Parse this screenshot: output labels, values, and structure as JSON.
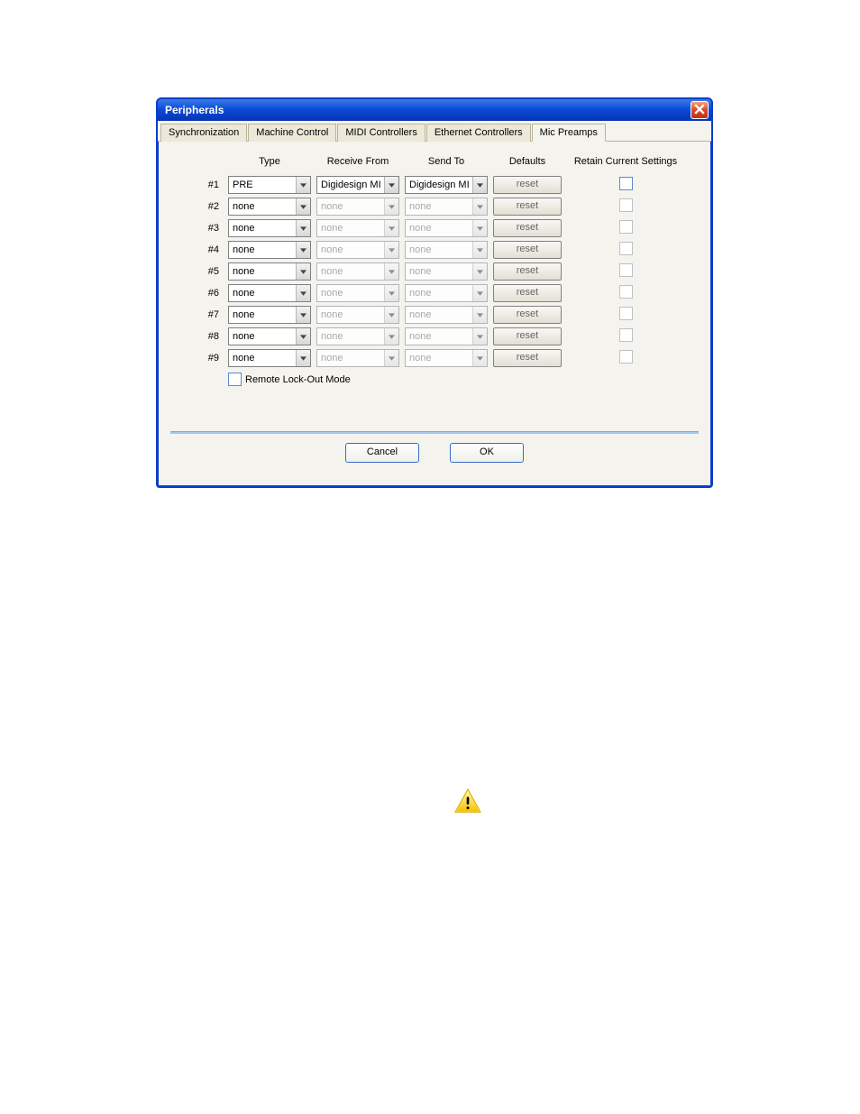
{
  "dialog": {
    "title": "Peripherals",
    "tabs": [
      {
        "label": "Synchronization",
        "active": false
      },
      {
        "label": "Machine Control",
        "active": false
      },
      {
        "label": "MIDI Controllers",
        "active": false
      },
      {
        "label": "Ethernet Controllers",
        "active": false
      },
      {
        "label": "Mic Preamps",
        "active": true
      }
    ],
    "columns": {
      "type": "Type",
      "receive": "Receive From",
      "send": "Send To",
      "defaults": "Defaults",
      "retain": "Retain Current Settings"
    },
    "rows": [
      {
        "num": "#1",
        "type": "PRE",
        "receive": "Digidesign MI",
        "send": "Digidesign MI",
        "reset": "reset",
        "enabled": true,
        "retain": false
      },
      {
        "num": "#2",
        "type": "none",
        "receive": "none",
        "send": "none",
        "reset": "reset",
        "enabled": false,
        "retain": false
      },
      {
        "num": "#3",
        "type": "none",
        "receive": "none",
        "send": "none",
        "reset": "reset",
        "enabled": false,
        "retain": false
      },
      {
        "num": "#4",
        "type": "none",
        "receive": "none",
        "send": "none",
        "reset": "reset",
        "enabled": false,
        "retain": false
      },
      {
        "num": "#5",
        "type": "none",
        "receive": "none",
        "send": "none",
        "reset": "reset",
        "enabled": false,
        "retain": false
      },
      {
        "num": "#6",
        "type": "none",
        "receive": "none",
        "send": "none",
        "reset": "reset",
        "enabled": false,
        "retain": false
      },
      {
        "num": "#7",
        "type": "none",
        "receive": "none",
        "send": "none",
        "reset": "reset",
        "enabled": false,
        "retain": false
      },
      {
        "num": "#8",
        "type": "none",
        "receive": "none",
        "send": "none",
        "reset": "reset",
        "enabled": false,
        "retain": false
      },
      {
        "num": "#9",
        "type": "none",
        "receive": "none",
        "send": "none",
        "reset": "reset",
        "enabled": false,
        "retain": false
      }
    ],
    "lockout_label": "Remote Lock-Out Mode",
    "lockout_checked": false,
    "buttons": {
      "cancel": "Cancel",
      "ok": "OK"
    }
  },
  "icons": {
    "close": "close-icon",
    "chevron": "chevron-down-icon",
    "warning": "warning-icon"
  }
}
